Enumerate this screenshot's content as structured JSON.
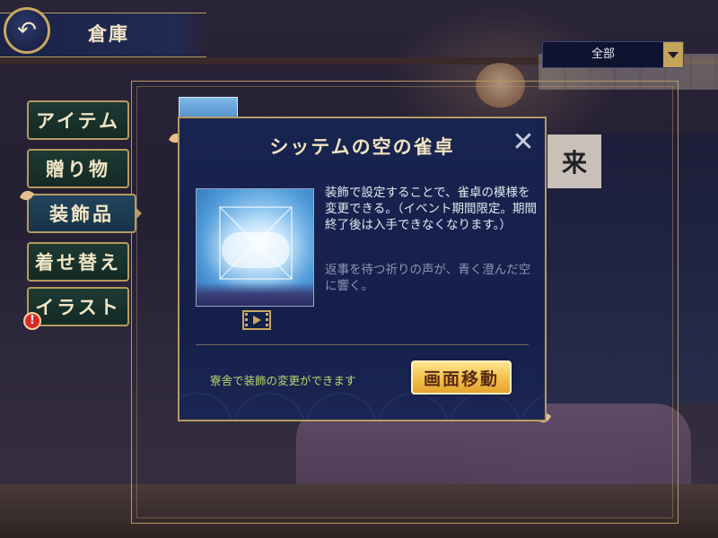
{
  "header": {
    "back_icon": "back-arrow-icon",
    "title": "倉庫"
  },
  "filter": {
    "selected": "全部",
    "arrow_icon": "chevron-down-icon"
  },
  "tabs": [
    {
      "label": "アイテム",
      "active": false
    },
    {
      "label": "贈り物",
      "active": false
    },
    {
      "label": "装飾品",
      "active": true
    },
    {
      "label": "着せ替え",
      "active": false
    },
    {
      "label": "イラスト",
      "active": false,
      "alert": "!"
    }
  ],
  "modal": {
    "title": "シッテムの空の雀卓",
    "close_icon": "close-icon",
    "description": "装飾で設定することで、雀卓の模様を変更できる。（イベント期間限定。期間終了後は入手できなくなります。）",
    "flavor": "返事を待つ祈りの声が、青く澄んだ空に響く。",
    "video_icon": "film-icon",
    "note": "寮舎で装飾の変更ができます",
    "goto_button": "画面移動"
  },
  "colors": {
    "gold": "#b89a5e",
    "modal_bg": "#182450",
    "note": "#b7d96d",
    "button": "#f2bf4a"
  }
}
